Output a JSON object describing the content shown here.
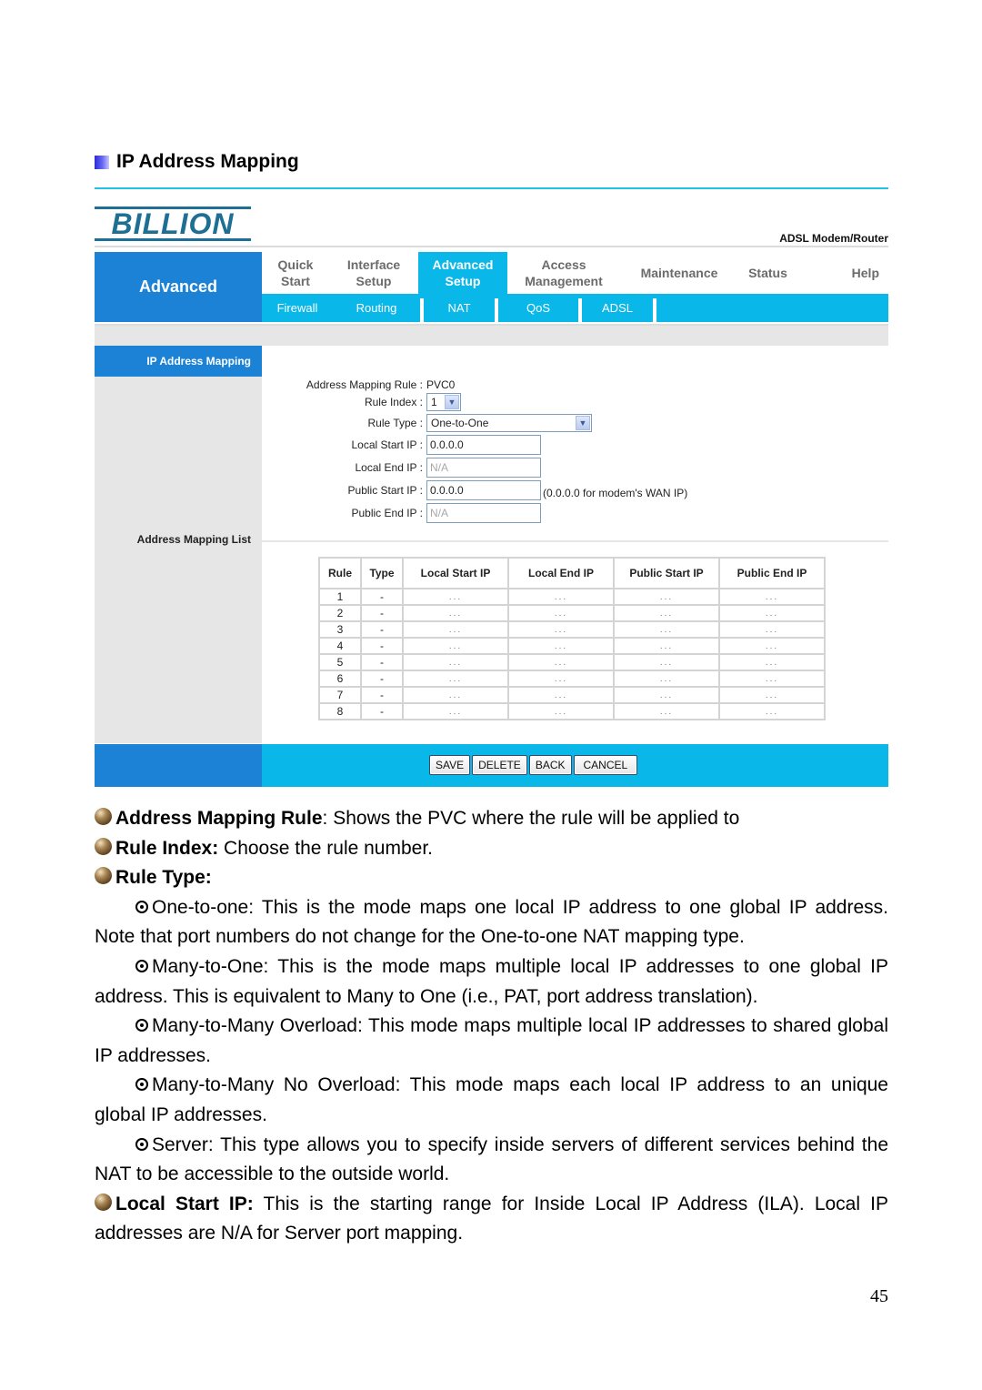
{
  "section": {
    "title": "IP Address Mapping"
  },
  "router": {
    "brand": "BILLION",
    "product": "ADSL Modem/Router",
    "side_title": "Advanced",
    "main_nav": [
      {
        "label": "Quick\nStart",
        "active": false
      },
      {
        "label": "Interface\nSetup",
        "active": false
      },
      {
        "label": "Advanced\nSetup",
        "active": true
      },
      {
        "label": "Access\nManagement",
        "active": false
      },
      {
        "label": "Maintenance",
        "active": false
      },
      {
        "label": "Status",
        "active": false
      },
      {
        "label": "Help",
        "active": false
      }
    ],
    "sub_nav": [
      "Firewall",
      "Routing",
      "NAT",
      "QoS",
      "ADSL"
    ],
    "left_active": "IP Address Mapping",
    "left_list": "Address Mapping List",
    "form": {
      "rule_label": "Address Mapping Rule :",
      "rule_value": "PVC0",
      "index_label": "Rule Index :",
      "index_value": "1",
      "type_label": "Rule Type :",
      "type_value": "One-to-One",
      "local_start_label": "Local Start IP :",
      "local_start_value": "0.0.0.0",
      "local_end_label": "Local End IP :",
      "local_end_value": "N/A",
      "public_start_label": "Public Start IP :",
      "public_start_value": "0.0.0.0",
      "public_start_hint": "(0.0.0.0 for modem's WAN IP)",
      "public_end_label": "Public End IP :",
      "public_end_value": "N/A"
    },
    "table": {
      "headers": [
        "Rule",
        "Type",
        "Local Start IP",
        "Local End IP",
        "Public Start IP",
        "Public End IP"
      ],
      "rows": [
        [
          "1",
          "-",
          "...",
          "...",
          "...",
          "..."
        ],
        [
          "2",
          "-",
          "...",
          "...",
          "...",
          "..."
        ],
        [
          "3",
          "-",
          "...",
          "...",
          "...",
          "..."
        ],
        [
          "4",
          "-",
          "...",
          "...",
          "...",
          "..."
        ],
        [
          "5",
          "-",
          "...",
          "...",
          "...",
          "..."
        ],
        [
          "6",
          "-",
          "...",
          "...",
          "...",
          "..."
        ],
        [
          "7",
          "-",
          "...",
          "...",
          "...",
          "..."
        ],
        [
          "8",
          "-",
          "...",
          "...",
          "...",
          "..."
        ]
      ]
    },
    "buttons": {
      "save": "SAVE",
      "delete": "DELETE",
      "back": "BACK",
      "cancel": "CANCEL"
    }
  },
  "doc": {
    "amr_term": "Address Mapping Rule",
    "amr_text": ": Shows the PVC where the rule will be applied to",
    "ri_term": "Rule Index:",
    "ri_text": " Choose the rule number.",
    "rt_term": "Rule Type:",
    "types": [
      {
        "text": "One-to-one: This is the mode maps one local IP address to one global IP address. Note that port numbers do not change for the One-to-one NAT mapping type."
      },
      {
        "text": "Many-to-One: This is the mode maps multiple local IP addresses to one global IP address. This is equivalent to Many to One (i.e., PAT, port address translation)."
      },
      {
        "text": "Many-to-Many Overload: This mode maps multiple local IP addresses to shared global IP addresses."
      },
      {
        "text": "Many-to-Many No Overload: This mode maps each local IP address to an unique global IP addresses."
      },
      {
        "text": "Server: This type allows you to specify inside servers of different services behind the NAT to be accessible to the outside world."
      }
    ],
    "lsip_term": "Local Start IP:",
    "lsip_text": " This is the starting range for Inside Local IP Address (ILA). Local IP addresses are N/A for Server port mapping."
  },
  "page_number": "45",
  "colors": {
    "accent_cyan": "#09b7e8",
    "accent_blue": "#1c82d6",
    "rule_line": "#21c2e6"
  }
}
